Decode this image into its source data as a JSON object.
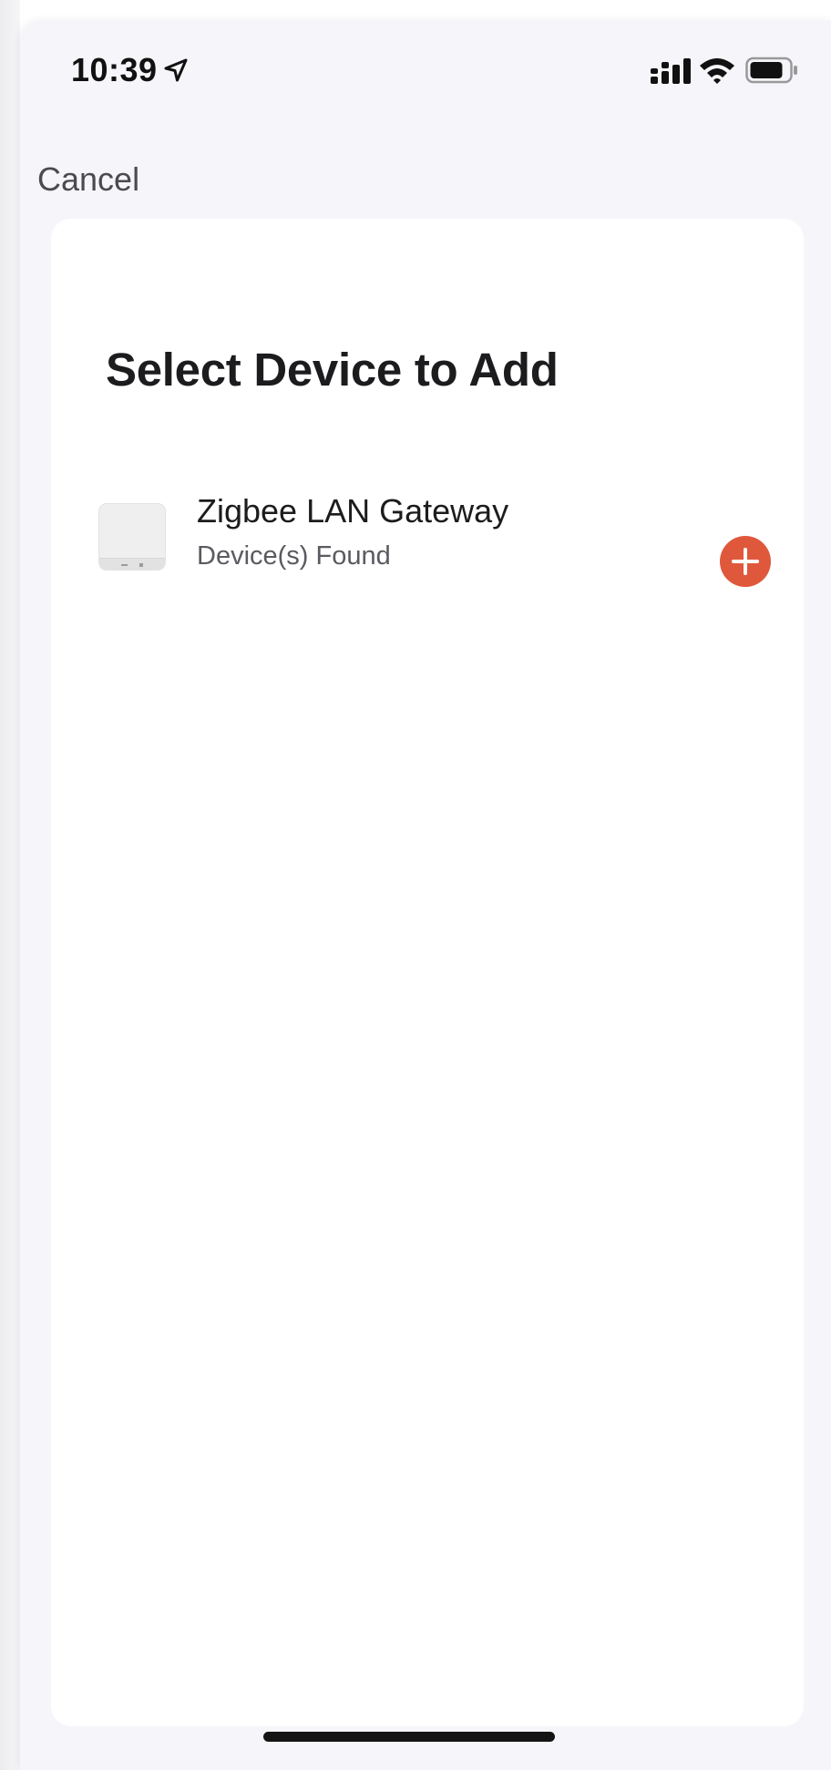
{
  "status_bar": {
    "time": "10:39",
    "icons": [
      "location-arrow-icon",
      "cellular-signal-icon",
      "wifi-icon",
      "battery-icon"
    ]
  },
  "nav": {
    "cancel_label": "Cancel"
  },
  "main": {
    "title": "Select Device to Add",
    "devices": [
      {
        "name": "Zigbee LAN Gateway",
        "status": "Device(s) Found",
        "icon": "zigbee-gateway-icon",
        "action_icon": "add-circle-icon"
      }
    ]
  },
  "colors": {
    "accent": "#e0583c",
    "background": "#f6f6fa",
    "card": "#ffffff",
    "title_text": "#1c1c1e",
    "secondary_text": "#5a5a60"
  }
}
